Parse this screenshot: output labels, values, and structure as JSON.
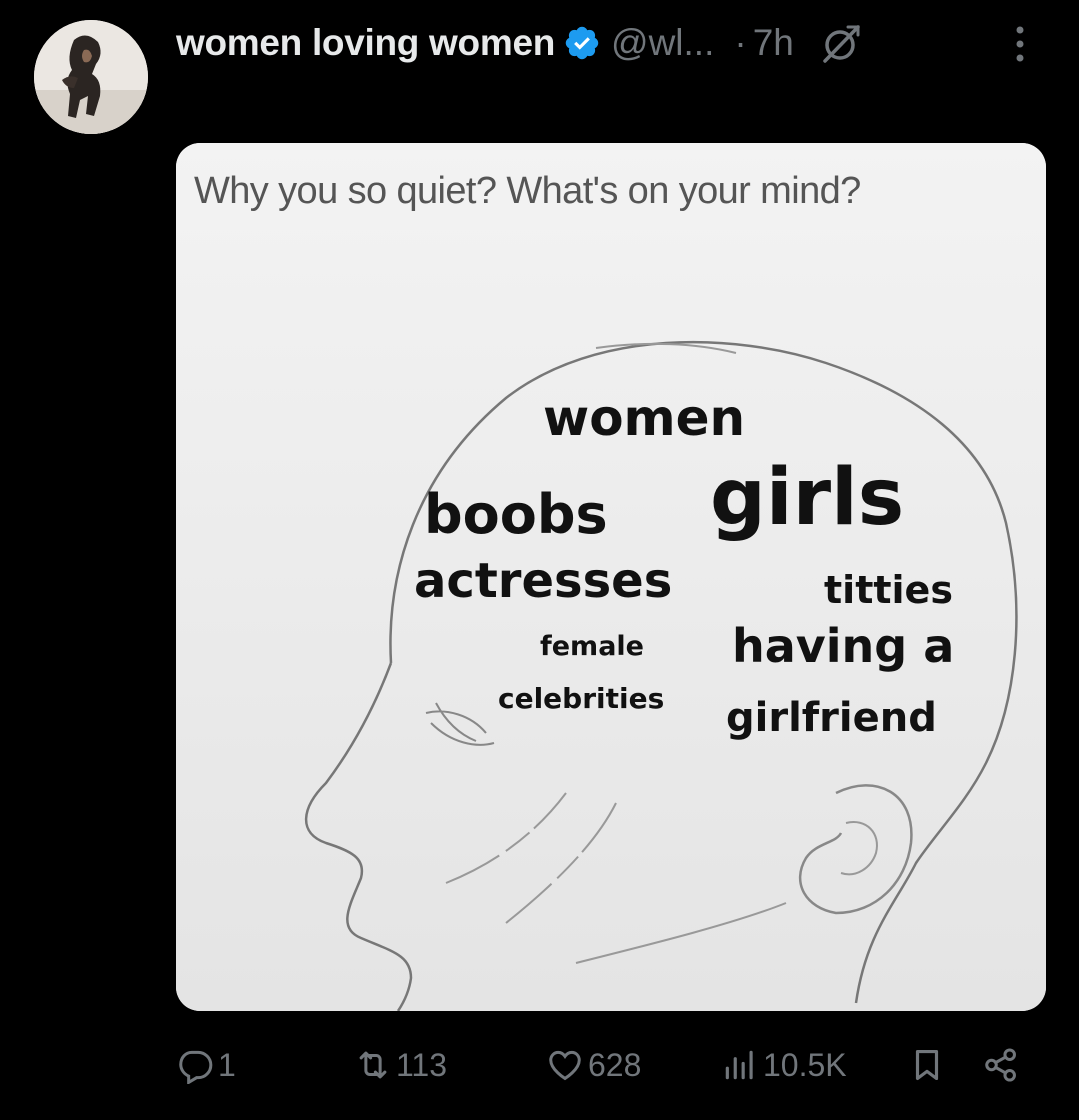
{
  "post": {
    "display_name": "women loving women",
    "verified_icon": "verified-badge-icon",
    "handle": "@wl...",
    "separator": "·",
    "time": "7h",
    "grok_icon": "grok-icon",
    "more_icon": "more-options-icon"
  },
  "meme": {
    "caption": "Why you so quiet? What's on your mind?",
    "words": {
      "women": "women",
      "boobs": "boobs",
      "girls": "girls",
      "actresses": "actresses",
      "titties": "titties",
      "female": "female",
      "having_a": "having a",
      "celebrities": "celebrities",
      "girlfriend": "girlfriend"
    }
  },
  "actions": {
    "replies": "1",
    "reposts": "113",
    "likes": "628",
    "views": "10.5K",
    "icons": [
      "reply-icon",
      "repost-icon",
      "like-icon",
      "views-icon",
      "bookmark-icon",
      "share-icon"
    ]
  },
  "colors": {
    "background": "#000000",
    "primary_text": "#e7e9ea",
    "secondary_text": "#71767b",
    "verified_blue": "#1d9bf0"
  }
}
